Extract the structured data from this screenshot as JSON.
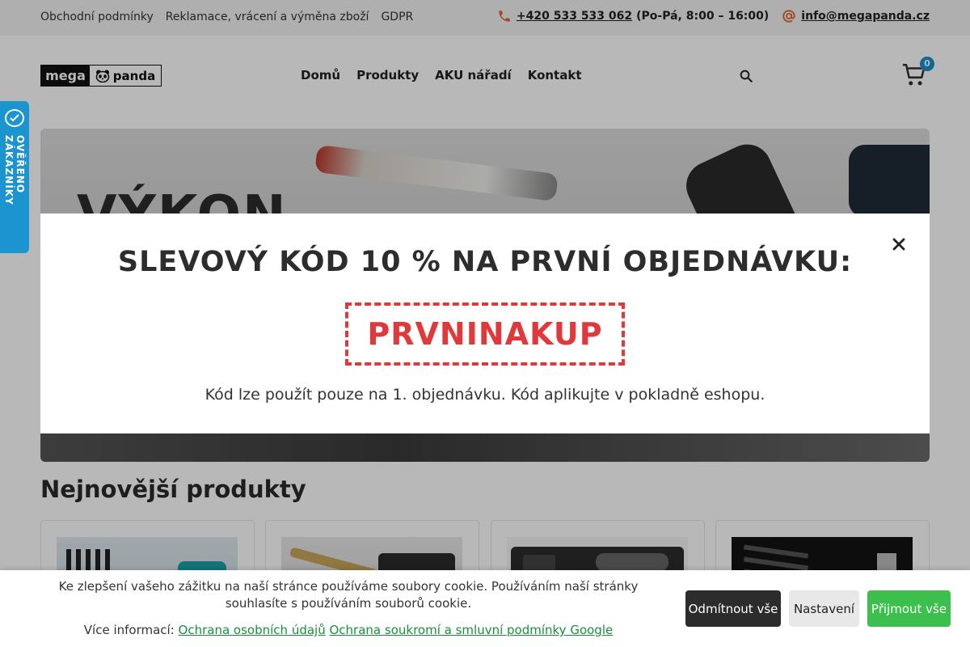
{
  "topbar": {
    "links": [
      "Obchodní podmínky",
      "Reklamace, vrácení a výměna zboží",
      "GDPR"
    ],
    "phone": "+420 533 533 062",
    "hours": "(Po-Pá, 8:00 – 16:00)",
    "email": "info@megapanda.cz"
  },
  "header": {
    "logo_left": "mega",
    "logo_right": "panda",
    "nav": [
      "Domů",
      "Produkty",
      "AKU nářadí",
      "Kontakt"
    ],
    "cart_count": "0"
  },
  "hero": {
    "headline": "VÝKON"
  },
  "side_badge": {
    "label": "OVĚŘENO ZÁKAZNÍKY"
  },
  "popup": {
    "title": "SLEVOVÝ KÓD 10 % NA PRVNÍ OBJEDNÁVKU:",
    "code": "PRVNINAKUP",
    "note": "Kód lze použít pouze na 1. objednávku. Kód aplikujte v pokladně eshopu."
  },
  "products": {
    "title": "Nejnovější produkty"
  },
  "cookie": {
    "message": "Ke zlepšení vašeho zážitku na naší stránce používáme soubory cookie. Používáním naší stránky souhlasíte s používáním souborů cookie.",
    "more_prefix": "Více informací:",
    "link_privacy": "Ochrana osobních údajů",
    "link_google": "Ochrana soukromí a smluvní podmínky Google",
    "reject_label": "Odmítnout vše",
    "settings_label": "Nastavení",
    "accept_label": "Přijmout vše"
  },
  "colors": {
    "accent_blue": "#1b94cf",
    "code_red": "#e0393b",
    "accept_green": "#3cbf4c",
    "icon_orange": "#e0693b"
  }
}
